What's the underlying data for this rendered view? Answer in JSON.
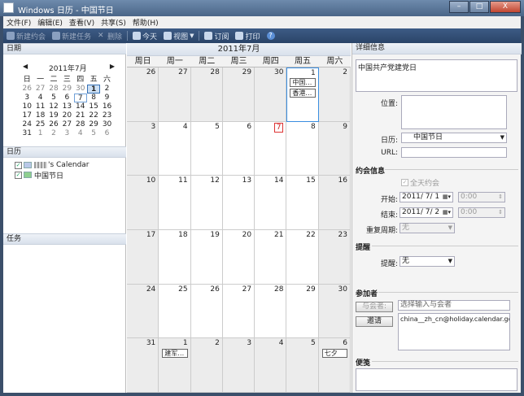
{
  "window": {
    "title": "Windows 日历 - 中国节日",
    "min": "–",
    "max": "□",
    "close": "X"
  },
  "menu": [
    "文件(F)",
    "编辑(E)",
    "查看(V)",
    "共享(S)",
    "帮助(H)"
  ],
  "toolbar": {
    "new_appointment": "新建约会",
    "new_task": "新建任务",
    "delete": "删除",
    "today": "今天",
    "view": "视图",
    "subscribe": "订阅",
    "print": "打印"
  },
  "left": {
    "date_header": "日期",
    "mini_calendar": {
      "prev": "◀",
      "next": "▶",
      "month_title": "2011年7月",
      "weekdays": [
        "日",
        "一",
        "二",
        "三",
        "四",
        "五",
        "六"
      ],
      "weeks": [
        [
          "26",
          "27",
          "28",
          "29",
          "30",
          "1",
          "2"
        ],
        [
          "3",
          "4",
          "5",
          "6",
          "7",
          "8",
          "9"
        ],
        [
          "10",
          "11",
          "12",
          "13",
          "14",
          "15",
          "16"
        ],
        [
          "17",
          "18",
          "19",
          "20",
          "21",
          "22",
          "23"
        ],
        [
          "24",
          "25",
          "26",
          "27",
          "28",
          "29",
          "30"
        ],
        [
          "31",
          "1",
          "2",
          "3",
          "4",
          "5",
          "6"
        ]
      ]
    },
    "calendar_header": "日历",
    "calendars": [
      {
        "name": "'s Calendar",
        "color": "#b9c8e8"
      },
      {
        "name": "中国节日",
        "color": "#8fcf8f"
      }
    ],
    "tasks_header": "任务"
  },
  "month_view": {
    "title": "2011年7月",
    "weekdays": [
      "周日",
      "周一",
      "周二",
      "周三",
      "周四",
      "周五",
      "周六"
    ],
    "weeks": [
      [
        "26",
        "27",
        "28",
        "29",
        "30",
        "1",
        "2"
      ],
      [
        "3",
        "4",
        "5",
        "6",
        "7",
        "8",
        "9"
      ],
      [
        "10",
        "11",
        "12",
        "13",
        "14",
        "15",
        "16"
      ],
      [
        "17",
        "18",
        "19",
        "20",
        "21",
        "22",
        "23"
      ],
      [
        "24",
        "25",
        "26",
        "27",
        "28",
        "29",
        "30"
      ],
      [
        "31",
        "1",
        "2",
        "3",
        "4",
        "5",
        "6"
      ]
    ],
    "events": [
      {
        "week": 0,
        "day": 5,
        "slot": 0,
        "text": "中国…"
      },
      {
        "week": 0,
        "day": 5,
        "slot": 1,
        "text": "香港…"
      },
      {
        "week": 5,
        "day": 1,
        "slot": 0,
        "text": "建军…"
      },
      {
        "week": 5,
        "day": 6,
        "slot": 0,
        "text": "七夕"
      }
    ]
  },
  "details": {
    "header": "详细信息",
    "title_value": "中国共产党建党日",
    "location_label": "位置:",
    "calendar_label": "日历:",
    "calendar_value": "中国节日",
    "url_label": "URL:",
    "appointment_section": "约会信息",
    "allday_label": "全天约会",
    "start_label": "开始:",
    "start_date": "2011/ 7/ 1",
    "start_time": "0:00",
    "end_label": "结束:",
    "end_date": "2011/ 7/ 2",
    "end_time": "0:00",
    "recur_label": "重复周期:",
    "recur_value": "无",
    "reminder_section": "提醒",
    "reminder_label": "提醒:",
    "reminder_value": "无",
    "attendees_section": "参加者",
    "attendee_button": "与会者:",
    "attendee_placeholder": "选择输入与会者",
    "invite_button": "邀请",
    "attendee_email": "china__zh_cn@holiday.calendar.gc",
    "notes_section": "便笺"
  },
  "colors": {
    "accent": "#3a8ee0",
    "toolbar": "#2a4468"
  }
}
